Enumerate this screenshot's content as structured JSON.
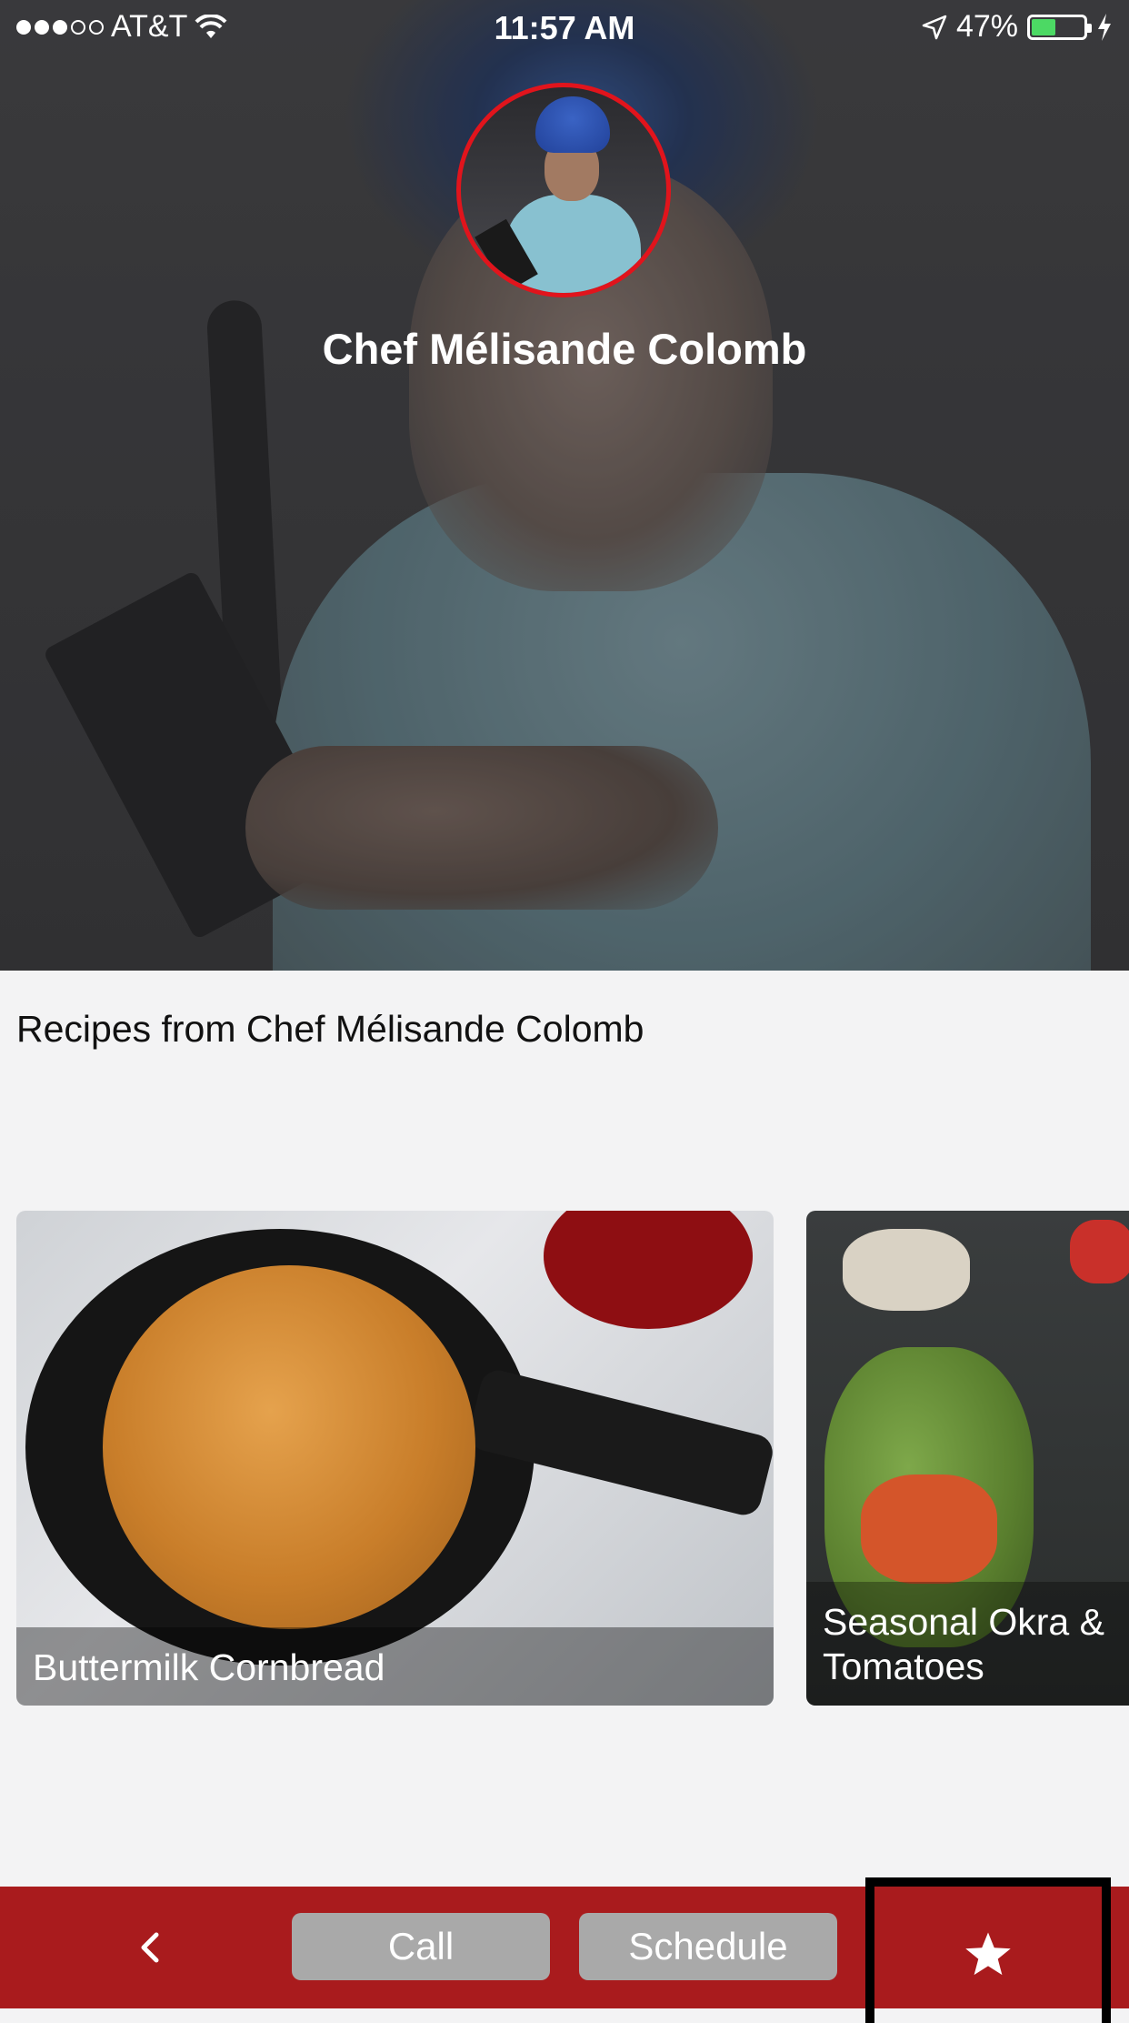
{
  "status_bar": {
    "carrier": "AT&T",
    "time": "11:57 AM",
    "battery_percent": "47%",
    "battery_level": 0.47,
    "signal_bars_filled": 3,
    "signal_bars_total": 5
  },
  "chef": {
    "name": "Chef Mélisande  Colomb"
  },
  "recipes_section": {
    "title": "Recipes from Chef Mélisande  Colomb",
    "items": [
      {
        "title": "Buttermilk Cornbread"
      },
      {
        "title": "Seasonal Okra & Tomatoes"
      }
    ]
  },
  "bottom_bar": {
    "call_label": "Call",
    "schedule_label": "Schedule"
  },
  "colors": {
    "accent_red": "#a91b1d",
    "avatar_ring": "#e1141c",
    "button_gray": "#a9a9a9"
  },
  "icons": {
    "back": "chevron-left-icon",
    "favorite": "star-icon",
    "wifi": "wifi-icon",
    "location": "location-arrow-icon",
    "charging": "bolt-icon"
  }
}
